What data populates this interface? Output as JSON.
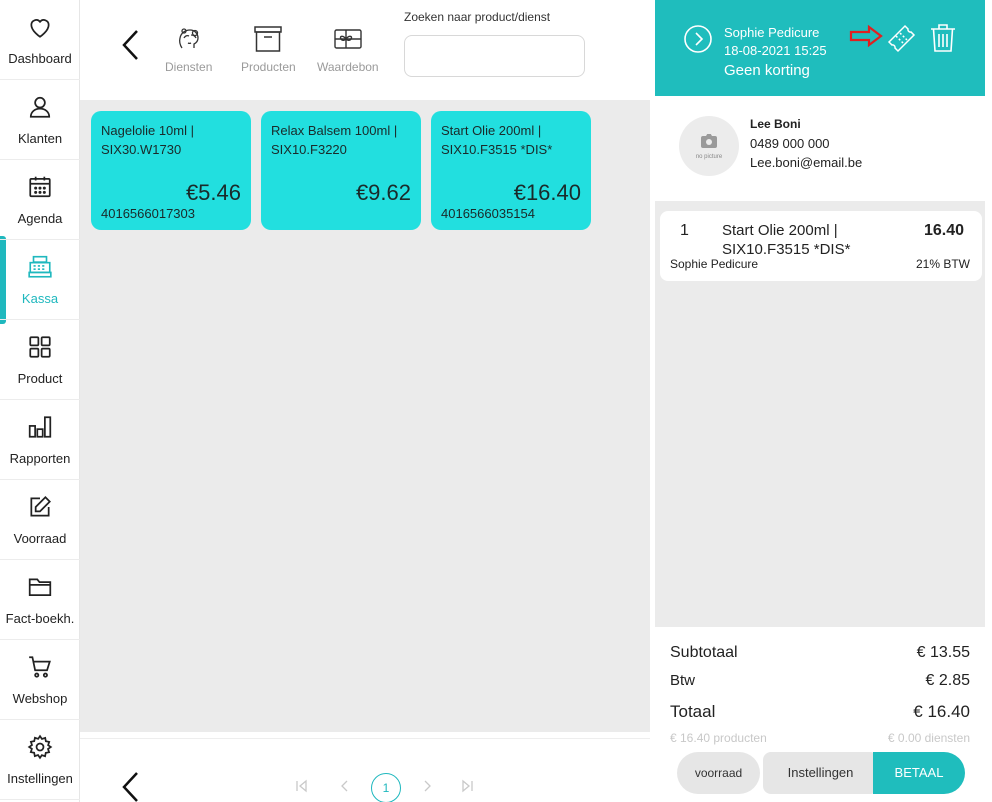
{
  "sidebar": {
    "items": [
      {
        "label": "Dashboard",
        "icon": "heart-icon"
      },
      {
        "label": "Klanten",
        "icon": "user-icon"
      },
      {
        "label": "Agenda",
        "icon": "calendar-icon"
      },
      {
        "label": "Kassa",
        "icon": "cash-register-icon"
      },
      {
        "label": "Product",
        "icon": "grid-icon"
      },
      {
        "label": "Rapporten",
        "icon": "bar-chart-icon"
      },
      {
        "label": "Voorraad",
        "icon": "edit-icon"
      },
      {
        "label": "Fact-boekh.",
        "icon": "folder-icon"
      },
      {
        "label": "Webshop",
        "icon": "cart-icon"
      },
      {
        "label": "Instellingen",
        "icon": "gear-icon"
      }
    ],
    "active_index": 3
  },
  "toolbar": {
    "tools": [
      {
        "label": "Diensten",
        "icon": "face-icon"
      },
      {
        "label": "Producten",
        "icon": "box-icon"
      },
      {
        "label": "Waardebon",
        "icon": "gift-card-icon"
      }
    ],
    "search_label": "Zoeken naar product/dienst",
    "search_value": ""
  },
  "products": [
    {
      "name": "Nagelolie 10ml | SIX30.W1730",
      "price": "€5.46",
      "barcode": "4016566017303"
    },
    {
      "name": "Relax Balsem 100ml | SIX10.F3220",
      "price": "€9.62",
      "barcode": ""
    },
    {
      "name": "Start Olie 200ml | SIX10.F3515 *DIS*",
      "price": "€16.40",
      "barcode": "4016566035154"
    }
  ],
  "pagination": {
    "current_page": "1"
  },
  "ticket": {
    "employee": "Sophie Pedicure",
    "datetime": "18-08-2021 15:25",
    "discount": "Geen korting"
  },
  "customer": {
    "avatar_text": "no picture",
    "name": "Lee Boni",
    "phone": "0489 000 000",
    "email": "Lee.boni@email.be"
  },
  "cart": {
    "lines": [
      {
        "qty": "1",
        "name": "Start Olie 200ml | SIX10.F3515 *DIS*",
        "price": "16.40",
        "employee": "Sophie Pedicure",
        "vat": "21% BTW"
      }
    ]
  },
  "totals": {
    "subtotal_label": "Subtotaal",
    "subtotal": "€ 13.55",
    "vat_label": "Btw",
    "vat": "€ 2.85",
    "total_label": "Totaal",
    "total": "€ 16.40",
    "products_amount": "€ 16.40 producten",
    "services_amount": "€ 0.00 diensten"
  },
  "actions": {
    "stock": "voorraad",
    "settings": "Instellingen",
    "pay": "BETAAL"
  },
  "colors": {
    "accent": "#1fbdbd",
    "card": "#22dfdf",
    "annotation_arrow": "#e02020"
  }
}
